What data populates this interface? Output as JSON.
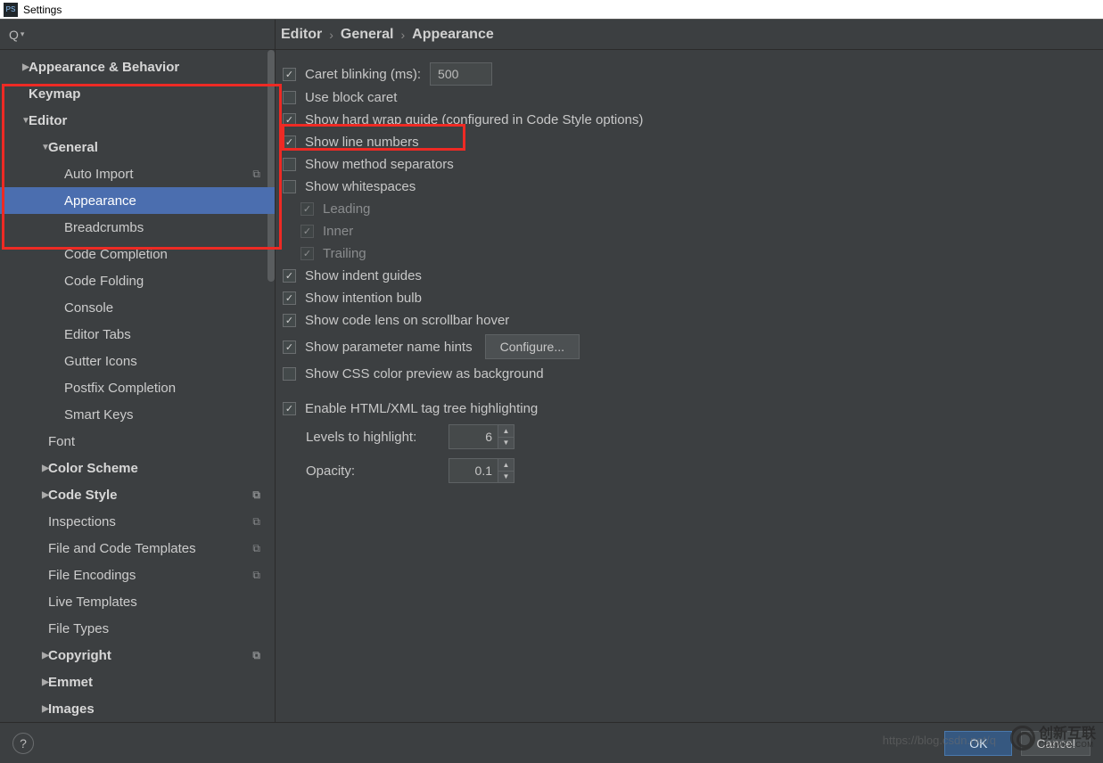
{
  "window": {
    "title": "Settings"
  },
  "search": {
    "placeholder": ""
  },
  "breadcrumb": [
    "Editor",
    "General",
    "Appearance"
  ],
  "sidebar": {
    "items": [
      {
        "label": "Appearance & Behavior",
        "level": 1,
        "bold": true,
        "arrow": "right"
      },
      {
        "label": "Keymap",
        "level": 1,
        "bold": true
      },
      {
        "label": "Editor",
        "level": 1,
        "bold": true,
        "arrow": "down"
      },
      {
        "label": "General",
        "level": 2,
        "bold": true,
        "arrow": "down"
      },
      {
        "label": "Auto Import",
        "level": 3,
        "copy": true
      },
      {
        "label": "Appearance",
        "level": 3,
        "selected": true
      },
      {
        "label": "Breadcrumbs",
        "level": 3
      },
      {
        "label": "Code Completion",
        "level": 3
      },
      {
        "label": "Code Folding",
        "level": 3
      },
      {
        "label": "Console",
        "level": 3
      },
      {
        "label": "Editor Tabs",
        "level": 3
      },
      {
        "label": "Gutter Icons",
        "level": 3
      },
      {
        "label": "Postfix Completion",
        "level": 3
      },
      {
        "label": "Smart Keys",
        "level": 3
      },
      {
        "label": "Font",
        "level": 2
      },
      {
        "label": "Color Scheme",
        "level": 2,
        "bold": true,
        "arrow": "right"
      },
      {
        "label": "Code Style",
        "level": 2,
        "bold": true,
        "arrow": "right",
        "copy": true
      },
      {
        "label": "Inspections",
        "level": 2,
        "copy": true
      },
      {
        "label": "File and Code Templates",
        "level": 2,
        "copy": true
      },
      {
        "label": "File Encodings",
        "level": 2,
        "copy": true
      },
      {
        "label": "Live Templates",
        "level": 2
      },
      {
        "label": "File Types",
        "level": 2
      },
      {
        "label": "Copyright",
        "level": 2,
        "bold": true,
        "arrow": "right",
        "copy": true
      },
      {
        "label": "Emmet",
        "level": 2,
        "bold": true,
        "arrow": "right"
      },
      {
        "label": "Images",
        "level": 2,
        "bold": true,
        "arrow": "right"
      }
    ]
  },
  "options": {
    "caretBlinking": {
      "label": "Caret blinking (ms):",
      "checked": true,
      "value": "500"
    },
    "useBlockCaret": {
      "label": "Use block caret",
      "checked": false
    },
    "showHardWrap": {
      "label": "Show hard wrap guide (configured in Code Style options)",
      "checked": true
    },
    "showLineNumbers": {
      "label": "Show line numbers",
      "checked": true
    },
    "showMethodSeparators": {
      "label": "Show method separators",
      "checked": false
    },
    "showWhitespaces": {
      "label": "Show whitespaces",
      "checked": false
    },
    "wsLeading": {
      "label": "Leading",
      "checked": true,
      "disabled": true
    },
    "wsInner": {
      "label": "Inner",
      "checked": true,
      "disabled": true
    },
    "wsTrailing": {
      "label": "Trailing",
      "checked": true,
      "disabled": true
    },
    "showIndentGuides": {
      "label": "Show indent guides",
      "checked": true
    },
    "showIntentionBulb": {
      "label": "Show intention bulb",
      "checked": true
    },
    "showCodeLens": {
      "label": "Show code lens on scrollbar hover",
      "checked": true
    },
    "showParamHints": {
      "label": "Show parameter name hints",
      "checked": true,
      "button": "Configure..."
    },
    "showCssColor": {
      "label": "Show CSS color preview as background",
      "checked": false
    },
    "enableTagTree": {
      "label": "Enable HTML/XML tag tree highlighting",
      "checked": true
    },
    "levelsToHighlight": {
      "label": "Levels to highlight:",
      "value": "6"
    },
    "opacity": {
      "label": "Opacity:",
      "value": "0.1"
    }
  },
  "footer": {
    "ok": "OK",
    "cancel": "Cancel"
  },
  "watermark": {
    "brand_top": "创新互联",
    "brand_bottom": "CDXWCX.COM",
    "url": "https://blog.csdn.net/q"
  }
}
